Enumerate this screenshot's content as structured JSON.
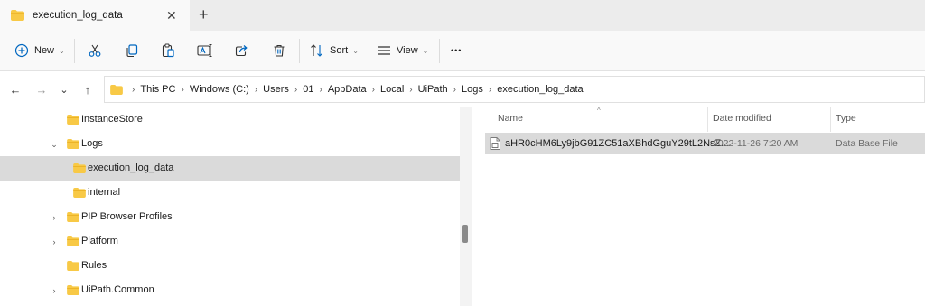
{
  "tab": {
    "title": "execution_log_data",
    "close_glyph": "✕",
    "new_tab_glyph": "+"
  },
  "toolbar": {
    "new_label": "New",
    "sort_label": "Sort",
    "view_label": "View",
    "more_glyph": "•••",
    "icons": [
      "cut-icon",
      "copy-icon",
      "paste-icon",
      "rename-icon",
      "share-icon",
      "delete-icon"
    ]
  },
  "nav_buttons": {
    "back": "←",
    "forward": "→",
    "recent": "⌄",
    "up": "↑"
  },
  "breadcrumb": [
    "This PC",
    "Windows (C:)",
    "Users",
    "01",
    "AppData",
    "Local",
    "UiPath",
    "Logs",
    "execution_log_data"
  ],
  "tree": [
    {
      "label": "InstanceStore",
      "expander": ""
    },
    {
      "label": "Logs",
      "expander": "expanded"
    },
    {
      "label": "execution_log_data",
      "expander": "",
      "selected": true
    },
    {
      "label": "internal",
      "expander": ""
    },
    {
      "label": "PIP Browser Profiles",
      "expander": "collapsed"
    },
    {
      "label": "Platform",
      "expander": "collapsed"
    },
    {
      "label": "Rules",
      "expander": ""
    },
    {
      "label": "UiPath.Common",
      "expander": "collapsed"
    }
  ],
  "columns": {
    "name": "Name",
    "date": "Date modified",
    "type": "Type"
  },
  "files": [
    {
      "name": "aHR0cHM6Ly9jbG91ZC51aXBhdGguY29tL2NsZ...",
      "date": "2022-11-26 7:20 AM",
      "type": "Data Base File"
    }
  ],
  "colors": {
    "folder": "#f8c946",
    "folder_dark": "#e6a817",
    "accent": "#0067c0",
    "selection": "#dadada"
  }
}
